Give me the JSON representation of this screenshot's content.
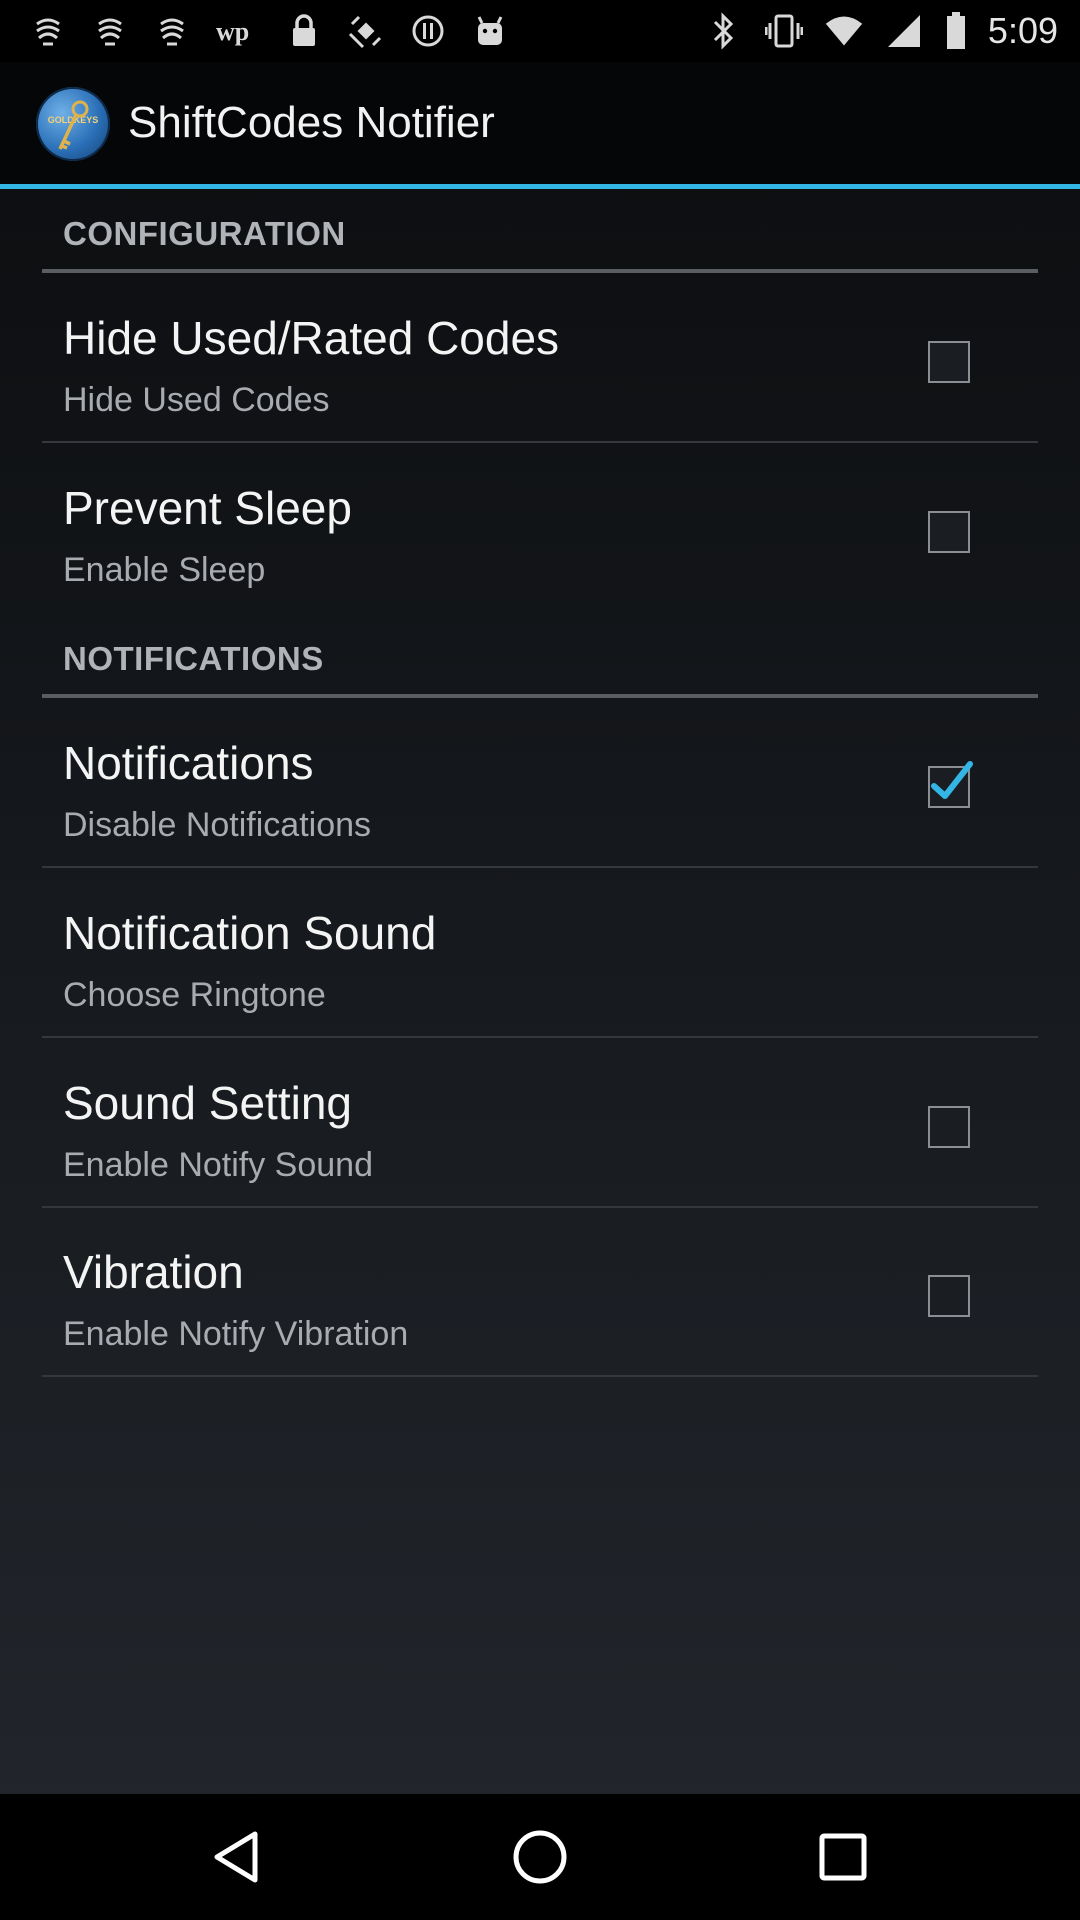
{
  "status_bar": {
    "time": "5:09",
    "left_icons": [
      "notification-icon",
      "notification-icon",
      "notification-icon",
      "wordpress-icon",
      "lock-icon",
      "gps-icon",
      "alert-icon",
      "android-icon"
    ],
    "right_icons": [
      "bluetooth-icon",
      "vibrate-icon",
      "wifi-icon",
      "signal-icon",
      "battery-icon"
    ]
  },
  "action_bar": {
    "title": "ShiftCodes Notifier",
    "logo_text": "GOLDKEYS"
  },
  "sections": [
    {
      "header": "CONFIGURATION",
      "items": [
        {
          "title": "Hide Used/Rated Codes",
          "summary": "Hide Used Codes",
          "checked": false
        },
        {
          "title": "Prevent Sleep",
          "summary": "Enable Sleep",
          "checked": false
        }
      ]
    },
    {
      "header": "NOTIFICATIONS",
      "items": [
        {
          "title": "Notifications",
          "summary": "Disable Notifications",
          "checked": true
        },
        {
          "title": "Notification Sound",
          "summary": "Choose Ringtone",
          "checked": null
        },
        {
          "title": "Sound Setting",
          "summary": "Enable Notify Sound",
          "checked": false
        },
        {
          "title": "Vibration",
          "summary": "Enable Notify Vibration",
          "checked": false
        }
      ]
    }
  ],
  "colors": {
    "accent": "#33b5e5",
    "background_top": "#0b0c0e",
    "background_bottom": "#23272d"
  }
}
